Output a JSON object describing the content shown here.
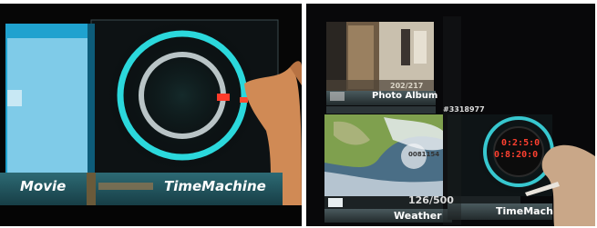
{
  "left_photo": {
    "movie_label": "Movie",
    "timemachine_label": "TimeMachine"
  },
  "right_photo": {
    "photo_album_label": "Photo Album",
    "photo_counter": "202/217",
    "photo_id": "#3318977",
    "weather_label": "Weather",
    "weather_counter": "126/500",
    "weather_time": "0081154",
    "timemachine_label": "TimeMach",
    "time_line_1": "0:2:5:0",
    "time_line_2": "0:8:20:0"
  }
}
